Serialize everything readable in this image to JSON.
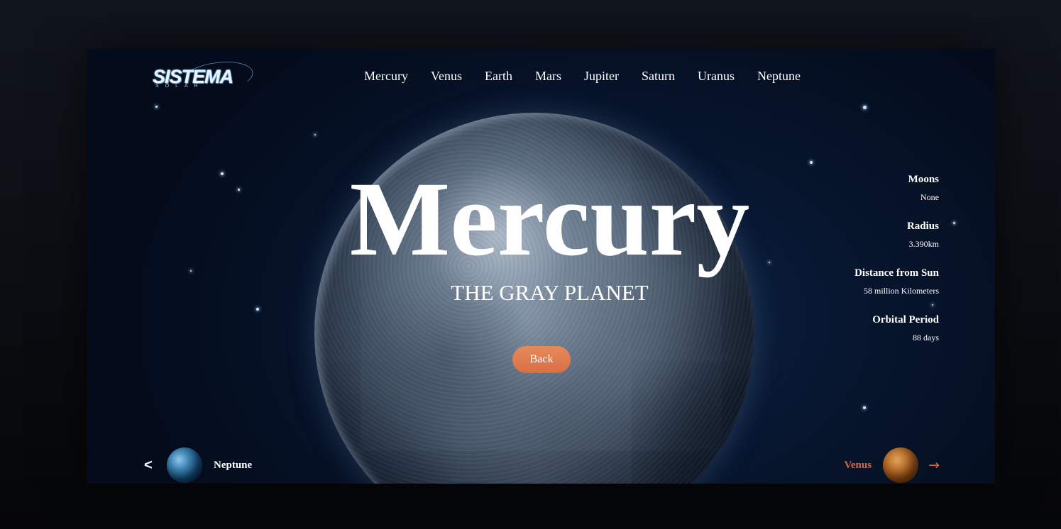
{
  "logo": {
    "main": "SISTEMA",
    "sub": "SOLAR"
  },
  "nav": {
    "items": [
      "Mercury",
      "Venus",
      "Earth",
      "Mars",
      "Jupiter",
      "Saturn",
      "Uranus",
      "Neptune"
    ]
  },
  "hero": {
    "title": "Mercury",
    "subtitle": "THE GRAY PLANET",
    "button_label": "Back"
  },
  "facts": [
    {
      "label": "Moons",
      "value": "None"
    },
    {
      "label": "Radius",
      "value": "3.390km"
    },
    {
      "label": "Distance from Sun",
      "value": "58 million Kilometers"
    },
    {
      "label": "Orbital Period",
      "value": "88 days"
    }
  ],
  "pager": {
    "prev_arrow": "<",
    "prev_label": "Neptune",
    "next_label": "Venus",
    "next_arrow": "→"
  },
  "colors": {
    "accent": "#e0643f",
    "button": "#e0784d",
    "background": "#07162f"
  },
  "icons": {
    "prev": "chevron-left-icon",
    "next": "arrow-right-icon"
  }
}
